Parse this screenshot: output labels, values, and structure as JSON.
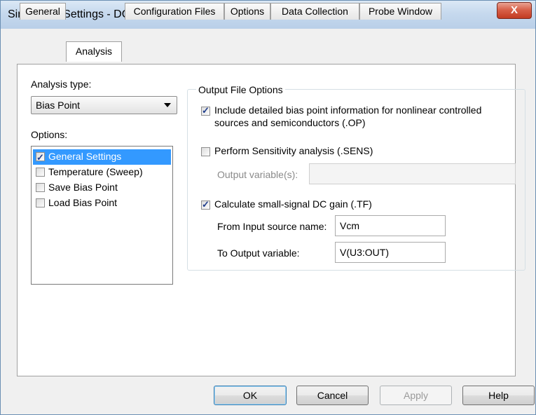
{
  "window": {
    "title": "Simulation Settings - DCOffset",
    "close_label": "X"
  },
  "tabs": [
    {
      "label": "General"
    },
    {
      "label": "Analysis"
    },
    {
      "label": "Configuration Files"
    },
    {
      "label": "Options"
    },
    {
      "label": "Data Collection"
    },
    {
      "label": "Probe Window"
    }
  ],
  "analysis": {
    "analysis_type_label": "Analysis type:",
    "analysis_type_value": "Bias Point",
    "options_label": "Options:",
    "options": [
      {
        "label": "General Settings",
        "checked": true,
        "selected": true
      },
      {
        "label": "Temperature (Sweep)",
        "checked": false,
        "selected": false
      },
      {
        "label": "Save Bias Point",
        "checked": false,
        "selected": false
      },
      {
        "label": "Load Bias Point",
        "checked": false,
        "selected": false
      }
    ]
  },
  "output_file_options": {
    "title": "Output File Options",
    "include_detailed": {
      "line1": "Include detailed bias point information for nonlinear controlled",
      "line2": "sources and semiconductors (.OP)",
      "checked": true
    },
    "sensitivity": {
      "label": "Perform Sensitivity analysis (.SENS)",
      "checked": false
    },
    "output_variables_label": "Output variable(s):",
    "output_variables_value": "",
    "dc_gain": {
      "label": "Calculate small-signal DC gain (.TF)",
      "checked": true
    },
    "from_input_label": "From Input source name:",
    "from_input_value": "Vcm",
    "to_output_label": "To Output variable:",
    "to_output_value": "V(U3:OUT)"
  },
  "buttons": {
    "ok": "OK",
    "cancel": "Cancel",
    "apply": "Apply",
    "help": "Help"
  }
}
